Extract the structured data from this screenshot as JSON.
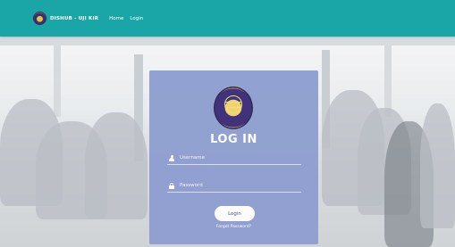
{
  "navbar": {
    "brand": "DISHUB - UJI KIR",
    "links": [
      "Home",
      "Login"
    ],
    "color": "#1aa6a6"
  },
  "login": {
    "title": "LOG IN",
    "username_placeholder": "Username",
    "password_placeholder": "Password",
    "button_label": "Login",
    "forgot_link": "Forgot Password?",
    "panel_color": "#8f9fd0"
  },
  "icons": [
    "dishub-logo-icon",
    "user-icon",
    "lock-icon"
  ]
}
